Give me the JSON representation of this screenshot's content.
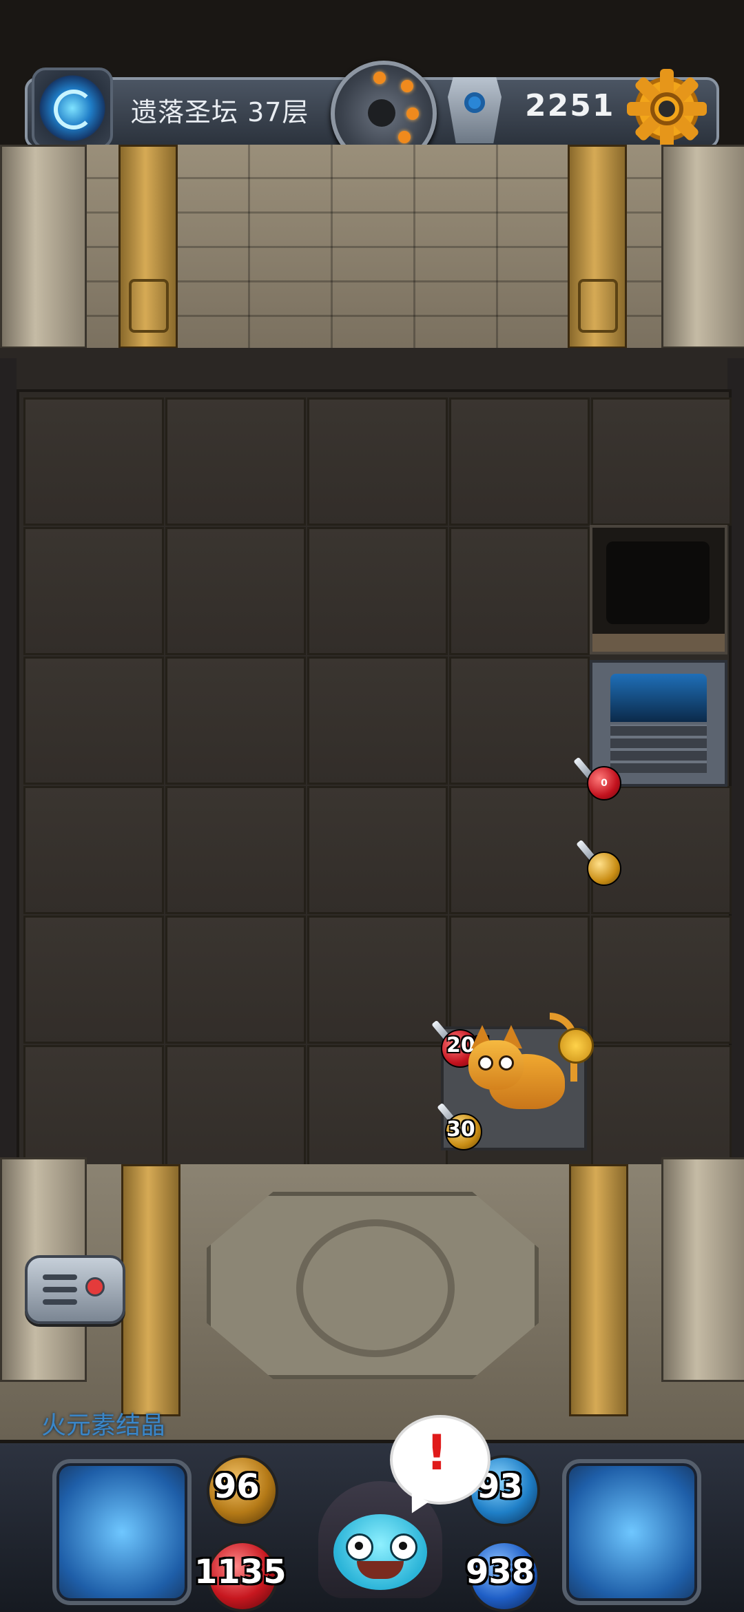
{
  "header": {
    "floor_label": "遗落圣坛 37层",
    "gold": "2251"
  },
  "board": {
    "red_orb_value": "0",
    "player": {
      "attack": "207",
      "defense": "30"
    }
  },
  "item_hint": "火元素结晶",
  "hud": {
    "attack": "96",
    "hp": "1135",
    "defense": "93",
    "mp": "938",
    "alert": "!"
  },
  "colors": {
    "accent_gold": "#f2a51a",
    "accent_blue": "#1f7fc7",
    "hp_red": "#c7171f"
  }
}
